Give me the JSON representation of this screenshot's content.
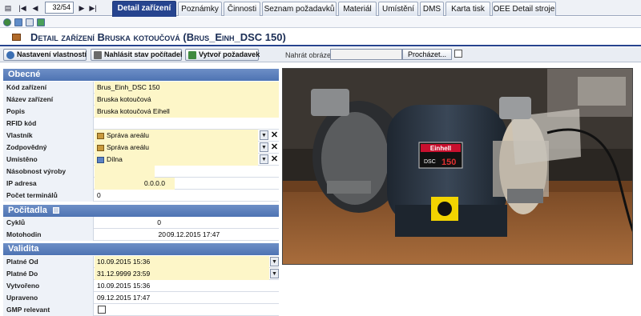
{
  "nav": {
    "record": "32/54"
  },
  "tabs": [
    {
      "label": "Detail zařízení",
      "active": true
    },
    {
      "label": "Poznámky"
    },
    {
      "label": "Činnosti"
    },
    {
      "label": "Seznam požadavků"
    },
    {
      "label": "Materiál"
    },
    {
      "label": "Umístění"
    },
    {
      "label": "DMS"
    },
    {
      "label": "Karta tisk"
    },
    {
      "label": "OEE Detail stroje"
    }
  ],
  "header": {
    "title": "Detail zařízení  Bruska kotoučová (Brus_Einh_DSC 150)"
  },
  "actions": {
    "settings": "Nastavení vlastností",
    "report": "Nahlásit stav počítadel",
    "create": "Vytvoř požadavek",
    "upload_label": "Nahrát obrázek stroje:",
    "browse": "Procházet..."
  },
  "sections": {
    "general": {
      "title": "Obecné",
      "rows": [
        {
          "label": "Kód zařízení",
          "value": "Brus_Einh_DSC 150"
        },
        {
          "label": "Název zařízení",
          "value": "Bruska kotoučová"
        },
        {
          "label": "Popis",
          "value": "Bruska kotoučová Eihell"
        },
        {
          "label": "RFID kód",
          "value": ""
        },
        {
          "label": "Vlastník",
          "value": "Správa areálu"
        },
        {
          "label": "Zodpovědný",
          "value": "Správa areálu"
        },
        {
          "label": "Umístěno",
          "value": "Dílna"
        },
        {
          "label": "Násobnost výroby",
          "value": ""
        },
        {
          "label": "IP adresa",
          "value": "0.0.0.0"
        },
        {
          "label": "Počet terminálů",
          "value": "0"
        }
      ]
    },
    "counters": {
      "title": "Počitadla",
      "rows": [
        {
          "label": "Cyklů",
          "value": "0",
          "extra": ""
        },
        {
          "label": "Motohodin",
          "value": "20",
          "extra": "09.12.2015 17:47"
        }
      ]
    },
    "validity": {
      "title": "Validita",
      "rows": [
        {
          "label": "Platné Od",
          "value": "10.09.2015 15:36"
        },
        {
          "label": "Platné Do",
          "value": "31.12.9999 23:59"
        },
        {
          "label": "Vytvořeno",
          "value": "10.09.2015 15:36"
        },
        {
          "label": "Upraveno",
          "value": "09.12.2015 17:47"
        },
        {
          "label": "GMP relevant",
          "value": ""
        }
      ]
    }
  },
  "photo": {
    "brand": "Einhell",
    "model_prefix": "DSC",
    "model_number": "150"
  },
  "colors": {
    "accent": "#26448f",
    "section": "#5a7dbb",
    "field": "#fdf6c8"
  }
}
